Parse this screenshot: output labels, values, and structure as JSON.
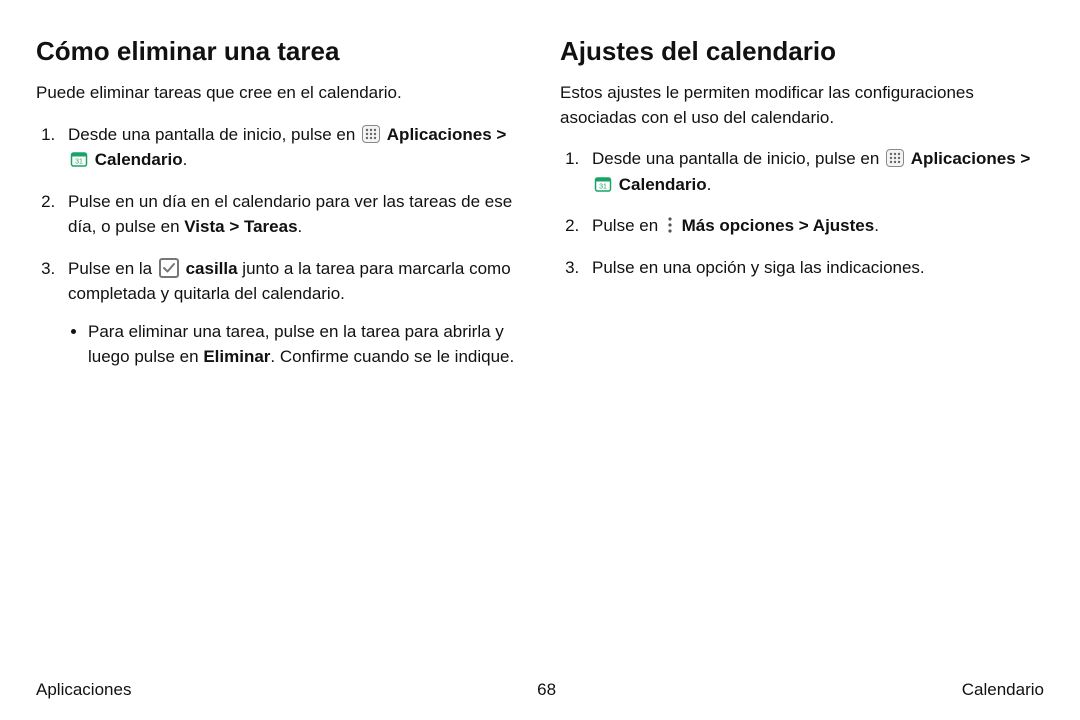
{
  "left": {
    "title": "Cómo eliminar una tarea",
    "intro": "Puede eliminar tareas que cree en el calendario.",
    "step1_pre": "Desde una pantalla de inicio, pulse en ",
    "apps_label": "Aplicaciones",
    "sep": " > ",
    "cal_label": "Calendario",
    "period": ".",
    "step2_a": "Pulse en un día en el calendario para ver las tareas de ese día, o pulse en ",
    "step2_bold": "Vista > Tareas",
    "step3_a": "Pulse en la ",
    "step3_bold1": "casilla",
    "step3_b": " junto a la tarea para marcarla como completada y quitarla del calendario.",
    "sub_a": "Para eliminar una tarea, pulse en la tarea para abrirla y luego pulse en ",
    "sub_bold": "Eliminar",
    "sub_b": ". Confirme cuando se le indique."
  },
  "right": {
    "title": "Ajustes del calendario",
    "intro": "Estos ajustes le permiten modificar las configuraciones asociadas con el uso del calendario.",
    "step1_pre": "Desde una pantalla de inicio, pulse en ",
    "apps_label": "Aplicaciones",
    "sep": " > ",
    "cal_label": "Calendario",
    "period": ".",
    "step2_a": "Pulse en ",
    "step2_bold": "Más opciones > Ajustes",
    "step3": "Pulse en una opción y siga las indicaciones."
  },
  "footer": {
    "left": "Aplicaciones",
    "center": "68",
    "right": "Calendario"
  }
}
